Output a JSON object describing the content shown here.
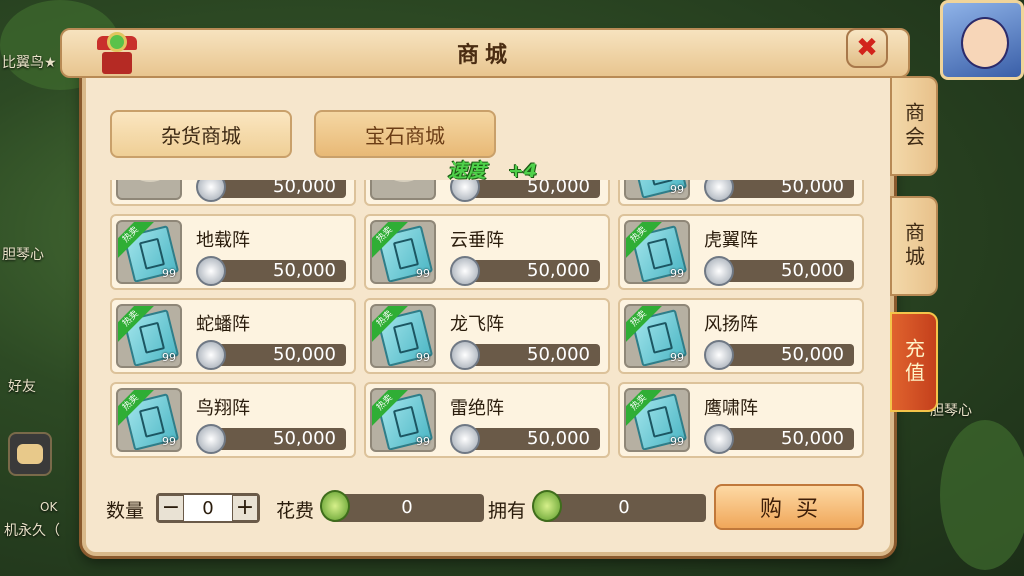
{
  "window": {
    "title": "商城"
  },
  "categories": [
    {
      "label": "杂货商城"
    },
    {
      "label": "宝石商城"
    }
  ],
  "side_tabs": [
    {
      "label": "商会"
    },
    {
      "label": "商城"
    },
    {
      "label": "充值"
    }
  ],
  "floating_text": {
    "stat": "速度",
    "delta": "+4"
  },
  "items": [
    {
      "name": "",
      "price": "50,000",
      "icon": "food-dish-icon",
      "count": ""
    },
    {
      "name": "",
      "price": "50,000",
      "icon": "food-dish-icon",
      "count": ""
    },
    {
      "name": "",
      "price": "50,000",
      "icon": "formation-book-icon",
      "count": "99"
    },
    {
      "name": "地载阵",
      "price": "50,000",
      "icon": "formation-book-icon",
      "badge": "热卖",
      "count": "99"
    },
    {
      "name": "云垂阵",
      "price": "50,000",
      "icon": "formation-book-icon",
      "badge": "热卖",
      "count": "99"
    },
    {
      "name": "虎翼阵",
      "price": "50,000",
      "icon": "formation-book-icon",
      "badge": "热卖",
      "count": "99"
    },
    {
      "name": "蛇蟠阵",
      "price": "50,000",
      "icon": "formation-book-icon",
      "badge": "热卖",
      "count": "99"
    },
    {
      "name": "龙飞阵",
      "price": "50,000",
      "icon": "formation-book-icon",
      "badge": "热卖",
      "count": "99"
    },
    {
      "name": "风扬阵",
      "price": "50,000",
      "icon": "formation-book-icon",
      "badge": "热卖",
      "count": "99"
    },
    {
      "name": "鸟翔阵",
      "price": "50,000",
      "icon": "formation-book-icon",
      "badge": "热卖",
      "count": "99"
    },
    {
      "name": "雷绝阵",
      "price": "50,000",
      "icon": "formation-book-icon",
      "badge": "热卖",
      "count": "99"
    },
    {
      "name": "鹰啸阵",
      "price": "50,000",
      "icon": "formation-book-icon",
      "badge": "热卖",
      "count": "99"
    }
  ],
  "purchase": {
    "quantity_label": "数量",
    "quantity_value": "0",
    "minus_label": "−",
    "plus_label": "+",
    "cost_label": "花费",
    "cost_value": "0",
    "own_label": "拥有",
    "own_value": "0",
    "buy_label": "购买"
  },
  "background": {
    "players": [
      "比翼鸟★",
      "胆琴心",
      "好友",
      "机永久（",
      "胆琴心"
    ],
    "chat_tag": "OK"
  },
  "colors": {
    "accent": "#e8b976",
    "price_bar": "#6a5a48",
    "recharge_tab": "#c4401c",
    "hot_badge": "#2fae35"
  }
}
